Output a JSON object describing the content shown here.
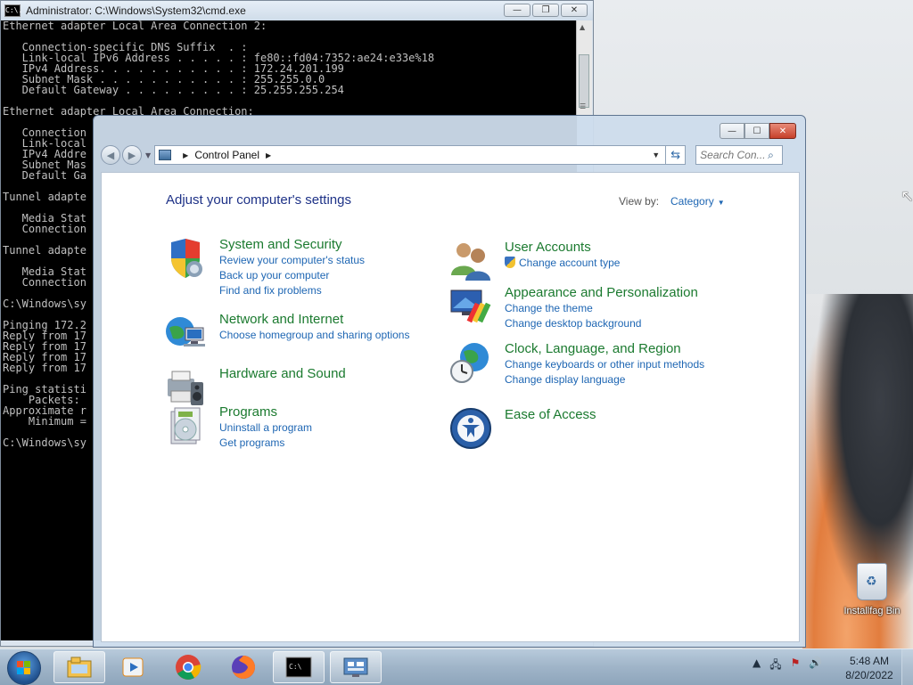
{
  "cmd": {
    "title": "Administrator: C:\\Windows\\System32\\cmd.exe",
    "icon_text": "C:\\.",
    "lines": [
      "Ethernet adapter Local Area Connection 2:",
      "",
      "   Connection-specific DNS Suffix  . :",
      "   Link-local IPv6 Address . . . . . : fe80::fd04:7352:ae24:e33e%18",
      "   IPv4 Address. . . . . . . . . . . : 172.24.201.199",
      "   Subnet Mask . . . . . . . . . . . : 255.255.0.0",
      "   Default Gateway . . . . . . . . . : 25.255.255.254",
      "",
      "Ethernet adapter Local Area Connection:",
      "",
      "   Connection",
      "   Link-local",
      "   IPv4 Addre",
      "   Subnet Mas",
      "   Default Ga",
      "",
      "Tunnel adapte",
      "",
      "   Media Stat",
      "   Connection",
      "",
      "Tunnel adapte",
      "",
      "   Media Stat",
      "   Connection",
      "",
      "C:\\Windows\\sy",
      "",
      "Pinging 172.2",
      "Reply from 17",
      "Reply from 17",
      "Reply from 17",
      "Reply from 17",
      "",
      "Ping statisti",
      "    Packets:",
      "Approximate r",
      "    Minimum =",
      "",
      "C:\\Windows\\sy"
    ]
  },
  "control_panel": {
    "breadcrumb": "Control Panel",
    "search_placeholder": "Search Con...",
    "heading": "Adjust your computer's settings",
    "view_by_label": "View by:",
    "view_by_value": "Category",
    "categories": [
      {
        "title": "System and Security",
        "icon": "shield-icon",
        "links": [
          "Review your computer's status",
          "Back up your computer",
          "Find and fix problems"
        ]
      },
      {
        "title": "Network and Internet",
        "icon": "globe-network-icon",
        "links": [
          "Choose homegroup and sharing options"
        ]
      },
      {
        "title": "Hardware and Sound",
        "icon": "printer-speaker-icon",
        "links": []
      },
      {
        "title": "Programs",
        "icon": "programs-icon",
        "links": [
          "Uninstall a program",
          "Get programs"
        ]
      },
      {
        "title": "User Accounts",
        "icon": "users-icon",
        "links": [
          "Change account type"
        ]
      },
      {
        "title": "Appearance and Personalization",
        "icon": "appearance-icon",
        "links": [
          "Change the theme",
          "Change desktop background"
        ]
      },
      {
        "title": "Clock, Language, and Region",
        "icon": "clock-globe-icon",
        "links": [
          "Change keyboards or other input methods",
          "Change display language"
        ]
      },
      {
        "title": "Ease of Access",
        "icon": "ease-of-access-icon",
        "links": []
      }
    ]
  },
  "desktop": {
    "recycle_bin_label": "Installfag Bin"
  },
  "taskbar": {
    "time": "5:48 AM",
    "date": "8/20/2022",
    "pinned": [
      "explorer-icon",
      "media-player-icon",
      "chrome-icon",
      "firefox-icon",
      "cmd-icon",
      "control-panel-icon"
    ]
  }
}
